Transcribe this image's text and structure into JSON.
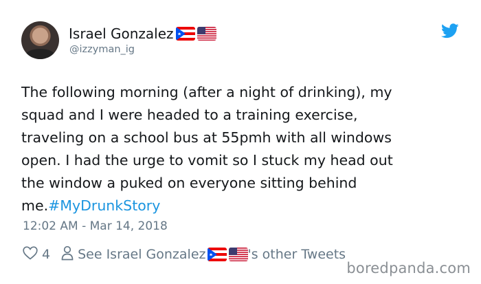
{
  "user": {
    "name": "Israel Gonzalez",
    "handle": "@izzyman_ig"
  },
  "tweet": {
    "lines": [
      "The following morning (after a night of drinking), my",
      "squad and I were headed to a training exercise,",
      "traveling on a school bus at 55pmh with all windows",
      "open. I had the urge to vomit so I stuck my head out",
      "the window a puked on everyone sitting behind",
      "me."
    ],
    "hashtag": "#MyDrunkStory",
    "timestamp": "12:02 AM - Mar 14, 2018"
  },
  "actions": {
    "like_count": "4",
    "see_prefix": "See Israel Gonzalez",
    "see_suffix": "'s other Tweets"
  },
  "watermark": "boredpanda.com",
  "icons": {
    "bird": "twitter-bird-icon",
    "like": "heart-icon",
    "profile": "person-icon"
  },
  "colors": {
    "twitter_blue": "#1da1f2",
    "hashtag": "#1b95e0",
    "secondary_text": "#657786"
  }
}
